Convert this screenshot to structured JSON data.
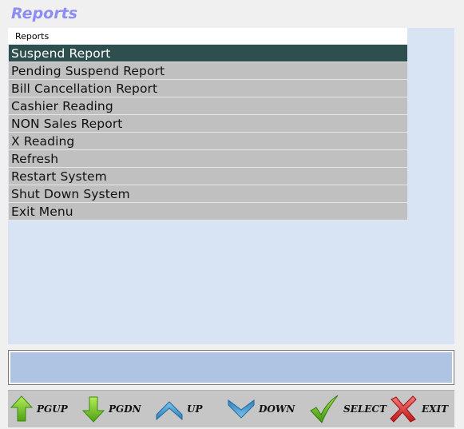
{
  "window": {
    "title": "Reports"
  },
  "menu": {
    "header": "Reports",
    "items": [
      {
        "label": "Suspend Report",
        "selected": true
      },
      {
        "label": "Pending Suspend Report"
      },
      {
        "label": "Bill Cancellation Report"
      },
      {
        "label": "Cashier Reading"
      },
      {
        "label": "NON Sales Report"
      },
      {
        "label": "X Reading"
      },
      {
        "label": "Refresh"
      },
      {
        "label": "Restart System"
      },
      {
        "label": "Shut Down System"
      },
      {
        "label": "Exit Menu"
      }
    ]
  },
  "status": {
    "text": ""
  },
  "toolbar": {
    "pgup": {
      "label": "PGUP",
      "icon": "green-up-arrow-icon"
    },
    "pgdn": {
      "label": "PGDN",
      "icon": "green-down-arrow-icon"
    },
    "up": {
      "label": "UP",
      "icon": "blue-chevron-up-icon"
    },
    "down": {
      "label": "DOWN",
      "icon": "blue-chevron-down-icon"
    },
    "select": {
      "label": "SELECT",
      "icon": "green-checkmark-icon"
    },
    "exit": {
      "label": "EXIT",
      "icon": "red-x-icon"
    }
  },
  "colors": {
    "title": "#8c8cf5",
    "selected_row": "#2f4f4f",
    "row": "#c0c0c0",
    "panel": "#d8e3f3",
    "status": "#afc4e2"
  }
}
